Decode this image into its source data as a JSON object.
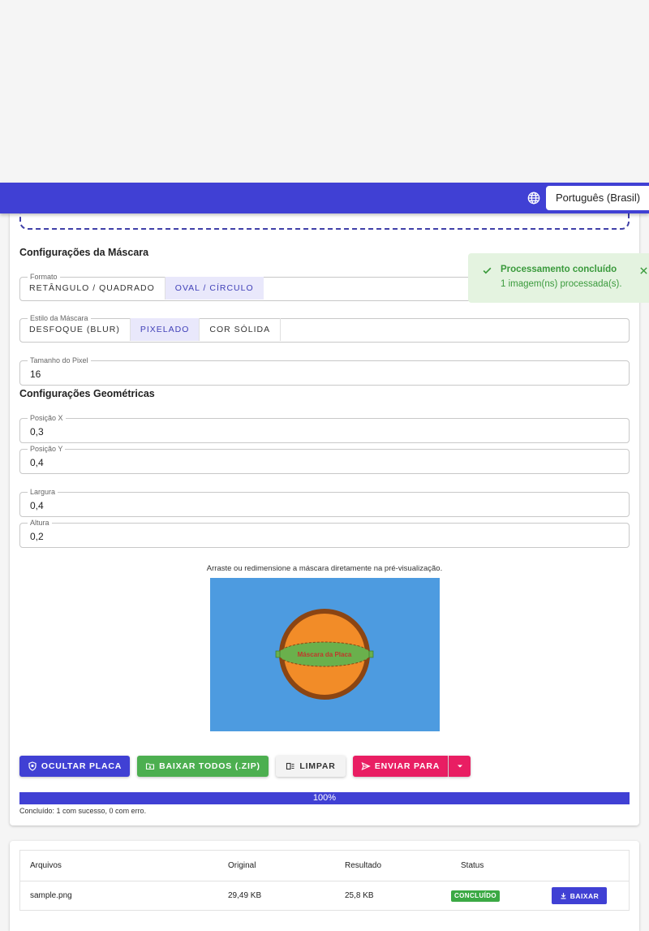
{
  "header": {
    "language_icon": "globe-icon",
    "language": "Português (Brasil)"
  },
  "mask_settings": {
    "title": "Configurações da Máscara",
    "format": {
      "legend": "Formato",
      "options": [
        "RETÂNGULO / QUADRADO",
        "OVAL / CÍRCULO"
      ],
      "selected": "OVAL / CÍRCULO"
    },
    "style": {
      "legend": "Estilo da Máscara",
      "options": [
        "DESFOQUE (BLUR)",
        "PIXELADO",
        "COR SÓLIDA"
      ],
      "selected": "PIXELADO"
    },
    "pixel_size": {
      "legend": "Tamanho do Pixel",
      "value": "16"
    }
  },
  "geometry": {
    "title": "Configurações Geométricas",
    "pos_x": {
      "legend": "Posição X",
      "value": "0,3"
    },
    "pos_y": {
      "legend": "Posição Y",
      "value": "0,4"
    },
    "width": {
      "legend": "Largura",
      "value": "0,4"
    },
    "height": {
      "legend": "Altura",
      "value": "0,2"
    }
  },
  "preview": {
    "hint": "Arraste ou redimensione a máscara diretamente na pré-visualização.",
    "mask_label": "Máscara da Placa",
    "colors": {
      "background": "#4d9be0",
      "circle_fill": "#f28c28",
      "circle_stroke": "#8b4513",
      "mask_fill": "#6ab04c",
      "mask_label": "#c0392b"
    }
  },
  "actions": {
    "hide_plate": "OCULTAR PLACA",
    "download_all": "BAIXAR TODOS (.ZIP)",
    "clear": "LIMPAR",
    "send_to": "ENVIAR PARA"
  },
  "progress": {
    "percent": 100,
    "label": "100%",
    "summary": "Concluído: 1 com sucesso, 0 com erro."
  },
  "toast": {
    "title": "Processamento concluído",
    "message": "1 imagem(ns) processada(s)."
  },
  "files": {
    "headers": [
      "Arquivos",
      "Original",
      "Resultado",
      "Status"
    ],
    "rows": [
      {
        "name": "sample.png",
        "original": "29,49 KB",
        "result": "25,8 KB",
        "status": "CONCLUÍDO",
        "action": "BAIXAR"
      }
    ]
  },
  "colors": {
    "primary": "#4040d4",
    "success": "#4caf50",
    "accent": "#e91e63"
  }
}
